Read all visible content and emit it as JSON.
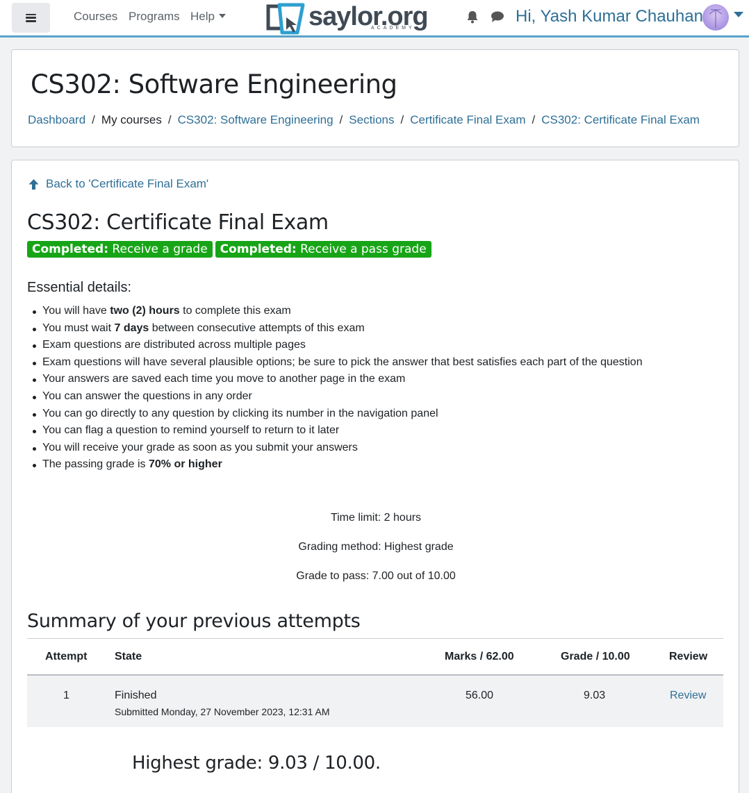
{
  "navbar": {
    "nav_links": [
      "Courses",
      "Programs",
      "Help"
    ],
    "logo_text": "saylor.org",
    "logo_subtext": "ACADEMY",
    "greeting": "Hi, Yash Kumar Chauhan!",
    "accent_color": "#57a3c8",
    "link_color": "#2e6f96"
  },
  "header": {
    "course_title": "CS302: Software Engineering",
    "breadcrumb": [
      "Dashboard",
      "My courses",
      "CS302: Software Engineering",
      "Sections",
      "Certificate Final Exam",
      "CS302: Certificate Final Exam"
    ],
    "separator": "/"
  },
  "main": {
    "back_link": "Back to 'Certificate Final Exam'",
    "quiz_title": "CS302: Certificate Final Exam",
    "badges": [
      {
        "strong": "Completed:",
        "text": " Receive a grade"
      },
      {
        "strong": "Completed:",
        "text": " Receive a pass grade"
      }
    ],
    "badge_color": "#17a517",
    "essential_heading": "Essential details:",
    "essential_items": [
      {
        "pre": "You will have ",
        "bold": "two (2) hours",
        "post": " to complete this exam"
      },
      {
        "pre": "You must wait ",
        "bold": "7 days",
        "post": " between consecutive attempts of this exam"
      },
      {
        "pre": "Exam questions are distributed across multiple pages",
        "bold": "",
        "post": ""
      },
      {
        "pre": "Exam questions will have several plausible options; be sure to pick the answer that best satisfies each part of the question",
        "bold": "",
        "post": ""
      },
      {
        "pre": "Your answers are saved each time you move to another page in the exam",
        "bold": "",
        "post": ""
      },
      {
        "pre": "You can answer the questions in any order",
        "bold": "",
        "post": ""
      },
      {
        "pre": "You can go directly to any question by clicking its number in the navigation panel",
        "bold": "",
        "post": ""
      },
      {
        "pre": "You can flag a question to remind yourself to return to it later",
        "bold": "",
        "post": ""
      },
      {
        "pre": "You will receive your grade as soon as you submit your answers",
        "bold": "",
        "post": ""
      },
      {
        "pre": "The passing grade is ",
        "bold": "70% or higher",
        "post": ""
      }
    ],
    "time_limit": "Time limit: 2 hours",
    "grading_method": "Grading method: Highest grade",
    "grade_to_pass": "Grade to pass: 7.00 out of 10.00",
    "summary_heading": "Summary of your previous attempts",
    "table_headers": {
      "attempt": "Attempt",
      "state": "State",
      "marks": "Marks / 62.00",
      "grade": "Grade / 10.00",
      "review": "Review"
    },
    "attempts": [
      {
        "attempt": "1",
        "state": "Finished",
        "submitted": "Submitted Monday, 27 November 2023, 12:31 AM",
        "marks": "56.00",
        "grade": "9.03",
        "review": "Review"
      }
    ],
    "highest_grade": "Highest grade: 9.03 / 10.00."
  }
}
